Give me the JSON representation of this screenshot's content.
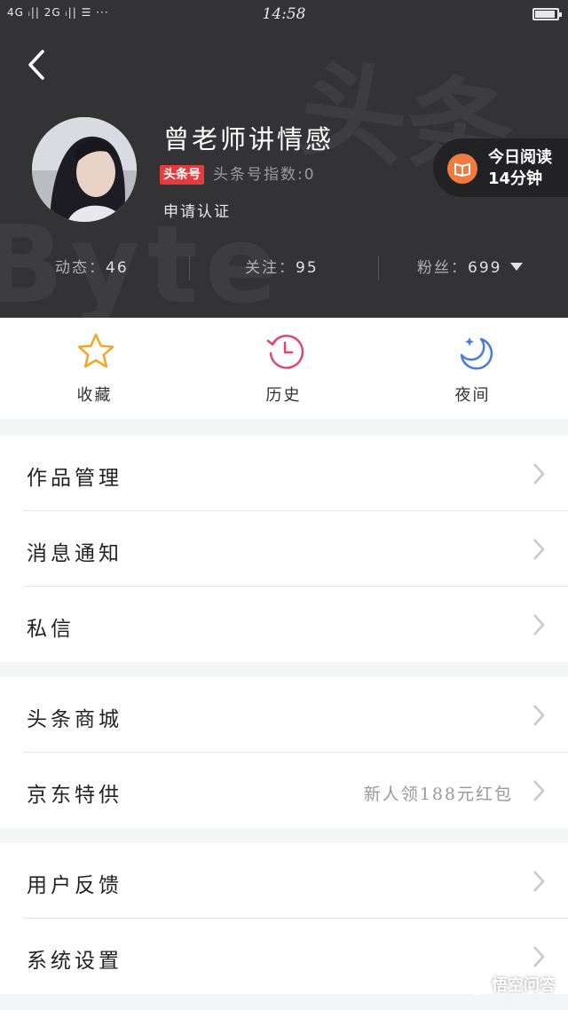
{
  "status_bar": {
    "signal": "4G ᵢ|| 2G ᵢ|| ☰ ···",
    "time": "14:58"
  },
  "profile": {
    "name": "曾老师讲情感",
    "badge": "头条号",
    "index_text": "头条号指数:0",
    "apply_label": "申请认证",
    "read_today_line1": "今日阅读",
    "read_today_line2": "14分钟"
  },
  "stats": {
    "dynamics_label": "动态：",
    "dynamics_value": "46",
    "following_label": "关注：",
    "following_value": "95",
    "fans_label": "粉丝：",
    "fans_value": "699"
  },
  "quick_actions": {
    "favorites": "收藏",
    "history": "历史",
    "night": "夜间"
  },
  "menu": {
    "group1": [
      "作品管理",
      "消息通知",
      "私信"
    ],
    "group2": [
      "头条商城",
      "京东特供"
    ],
    "group2_jd_extra": "新人领188元红包",
    "group3": [
      "用户反馈",
      "系统设置"
    ]
  },
  "watermark": "悟空问答",
  "colors": {
    "header_bg": "#333335",
    "badge_red": "#e43c3c",
    "star_orange": "#f5a623",
    "history_pink": "#e8416b",
    "night_blue": "#4a7bd8"
  }
}
